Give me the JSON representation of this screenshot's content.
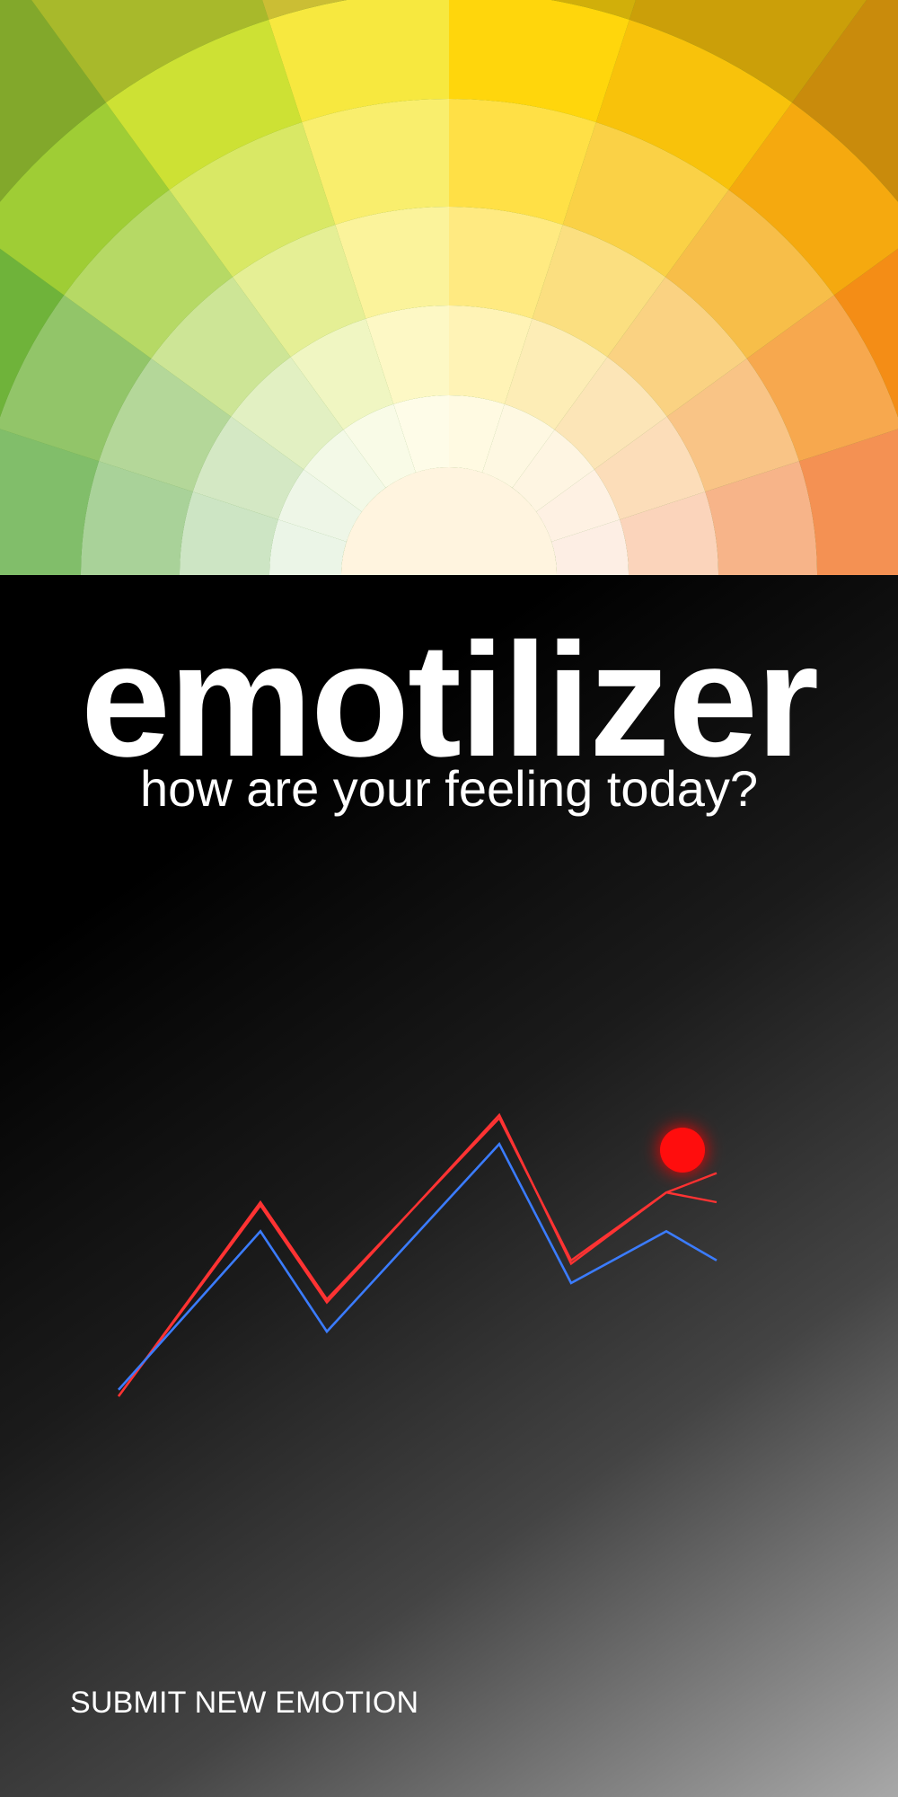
{
  "header": {
    "title": "emotilizer",
    "subtitle": "how are your feeling today?"
  },
  "actions": {
    "submit_label": "SUBMIT NEW EMOTION"
  },
  "theme": {
    "background": "#000000",
    "accent_red": "#ff1010",
    "line_red": "#ff3333",
    "line_blue": "#3b7cff",
    "wheel_colors": [
      "#59a93b",
      "#6fb33a",
      "#9fcd35",
      "#cde134",
      "#f7e83f",
      "#ffd60c",
      "#f8c20b",
      "#f5a90f",
      "#f48d16",
      "#f06e1d"
    ]
  },
  "chart_data": {
    "type": "line",
    "series": [
      {
        "values": [
          10,
          70,
          40,
          96,
          52,
          73,
          70
        ]
      },
      {
        "values": [
          10,
          69,
          39,
          97,
          51,
          73,
          79
        ]
      },
      {
        "values": [
          12,
          61,
          30,
          88,
          45,
          61,
          52
        ]
      }
    ],
    "ylim": [
      0,
      100
    ],
    "grid": false
  }
}
